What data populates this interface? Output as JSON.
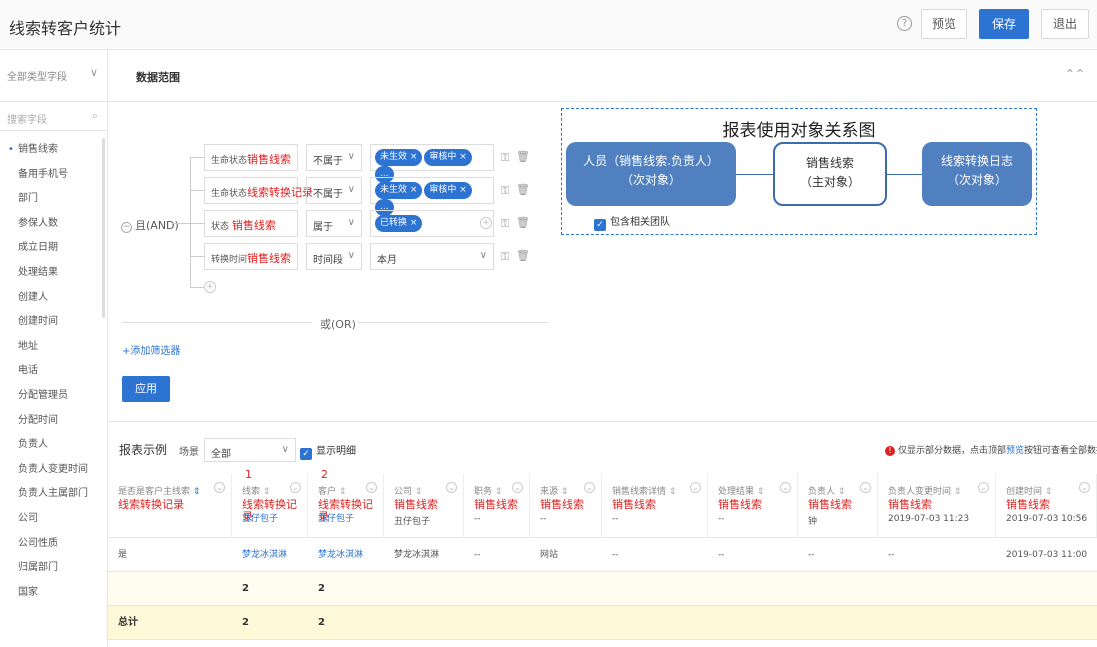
{
  "header": {
    "title": "线索转客户统计",
    "help": "?",
    "preview": "预览",
    "save": "保存",
    "exit": "退出"
  },
  "sidebar": {
    "type_select": "全部类型字段",
    "search_placeholder": "搜索字段",
    "items": [
      "销售线索",
      "备用手机号",
      "部门",
      "参保人数",
      "成立日期",
      "处理结果",
      "创建人",
      "创建时间",
      "地址",
      "电话",
      "分配管理员",
      "分配时间",
      "负责人",
      "负责人变更时间",
      "负责人主属部门",
      "公司",
      "公司性质",
      "归属部门",
      "国家"
    ]
  },
  "range": {
    "label": "数据范围"
  },
  "filters": {
    "and_label": "且(AND)",
    "rows": [
      {
        "field_small": "生命状态",
        "field_big": "销售线索",
        "op": "不属于",
        "tags": [
          "未生效",
          "审核中",
          "..."
        ]
      },
      {
        "field_small": "生命状态",
        "field_big": "线索转换记录",
        "op": "不属于",
        "tags": [
          "未生效",
          "审核中",
          "..."
        ]
      },
      {
        "field_small": "状态",
        "field_big": "销售线索",
        "op": "属于",
        "tags": [
          "已转换"
        ]
      },
      {
        "field_small": "转换时间",
        "field_big": "销售线索",
        "op": "时间段",
        "value": "本月"
      }
    ],
    "or_label": "或(OR)",
    "add": "+添加筛选器",
    "apply": "应用"
  },
  "diagram": {
    "title": "报表使用对象关系图",
    "left": [
      "人员（销售线索.负责人）",
      "（次对象）"
    ],
    "center": [
      "销售线索",
      "（主对象）"
    ],
    "right": [
      "线索转换日志",
      "（次对象）"
    ],
    "team": "包含相关团队"
  },
  "report": {
    "title": "报表示例",
    "scene_label": "场景",
    "scene": "全部",
    "detail": "显示明细",
    "notice_prefix": "仅显示部分数据，点击顶部",
    "notice_link": "预览",
    "notice_suffix": "按钮可查看全部数据"
  },
  "table": {
    "columns": [
      {
        "h": "是否是客户主线索",
        "hr": "线索转换记录",
        "cv": ""
      },
      {
        "h": "线索",
        "hr": "线索转换记录",
        "cv": "丑仔包子",
        "num": "1"
      },
      {
        "h": "客户",
        "hr": "线索转换记录",
        "cv": "丑仔包子",
        "num": "2"
      },
      {
        "h": "公司",
        "hr": "销售线索",
        "cv": "丑仔包子"
      },
      {
        "h": "职务",
        "hr": "销售线索",
        "cv": "--"
      },
      {
        "h": "来源",
        "hr": "销售线索",
        "cv": "--"
      },
      {
        "h": "销售线索详情",
        "hr": "销售线索",
        "cv": "--"
      },
      {
        "h": "处理结果",
        "hr": "销售线索",
        "cv": "--"
      },
      {
        "h": "负责人",
        "hr": "销售线索",
        "cv": "钟"
      },
      {
        "h": "负责人变更时间",
        "hr": "销售线索",
        "cv": "2019-07-03 11:23"
      },
      {
        "h": "创建时间",
        "hr": "销售线索",
        "cv": "2019-07-03 10:56"
      }
    ],
    "row2": [
      "是",
      "梦龙冰淇淋",
      "梦龙冰淇淋",
      "梦龙冰淇淋",
      "--",
      "网站",
      "--",
      "--",
      "--",
      "--",
      "2019-07-03 11:00"
    ],
    "subtotal": [
      "",
      "2",
      "2"
    ],
    "total": [
      "总计",
      "2",
      "2"
    ]
  }
}
